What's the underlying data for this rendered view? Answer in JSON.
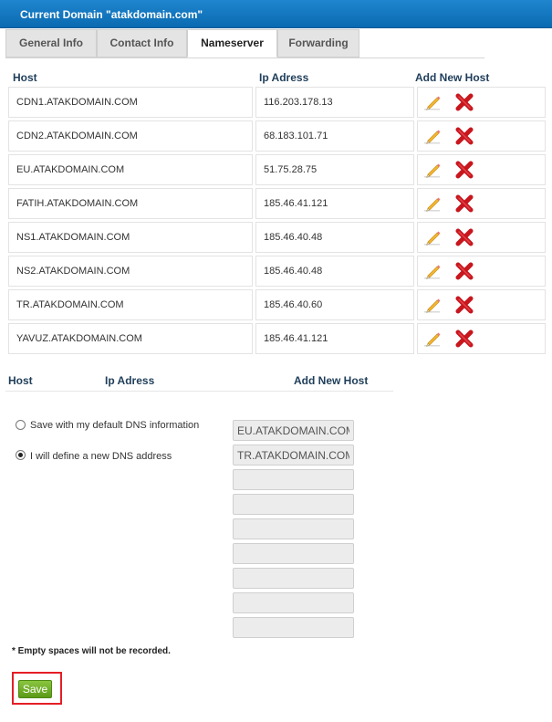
{
  "header": {
    "title": "Current Domain \"atakdomain.com\""
  },
  "tabs": [
    {
      "label": "General Info"
    },
    {
      "label": "Contact Info"
    },
    {
      "label": "Nameserver"
    },
    {
      "label": "Forwarding"
    }
  ],
  "active_tab": "Nameserver",
  "table": {
    "columns": {
      "host": "Host",
      "ip": "Ip Adress",
      "add": "Add New Host"
    },
    "rows": [
      {
        "host": "CDN1.ATAKDOMAIN.COM",
        "ip": "116.203.178.13"
      },
      {
        "host": "CDN2.ATAKDOMAIN.COM",
        "ip": "68.183.101.71"
      },
      {
        "host": "EU.ATAKDOMAIN.COM",
        "ip": "51.75.28.75"
      },
      {
        "host": "FATIH.ATAKDOMAIN.COM",
        "ip": "185.46.41.121"
      },
      {
        "host": "NS1.ATAKDOMAIN.COM",
        "ip": "185.46.40.48"
      },
      {
        "host": "NS2.ATAKDOMAIN.COM",
        "ip": "185.46.40.48"
      },
      {
        "host": "TR.ATAKDOMAIN.COM",
        "ip": "185.46.40.60"
      },
      {
        "host": "YAVUZ.ATAKDOMAIN.COM",
        "ip": "185.46.41.121"
      }
    ]
  },
  "add_section": {
    "host": "Host",
    "ip": "Ip Adress",
    "add": "Add New Host"
  },
  "dns_options": [
    {
      "label": "Save with my default DNS information",
      "selected": false
    },
    {
      "label": "I will define a new DNS address",
      "selected": true
    }
  ],
  "dns_fields": [
    "EU.ATAKDOMAIN.COM",
    "TR.ATAKDOMAIN.COM",
    "",
    "",
    "",
    "",
    "",
    ""
  ],
  "note": "* Empty spaces will not be recorded.",
  "save_label": "Save",
  "colors": {
    "header": "#0a6ab1",
    "save": "#6aab25",
    "highlight": "#e41e26",
    "delete": "#c8161d",
    "pencil": "#f2b632"
  }
}
